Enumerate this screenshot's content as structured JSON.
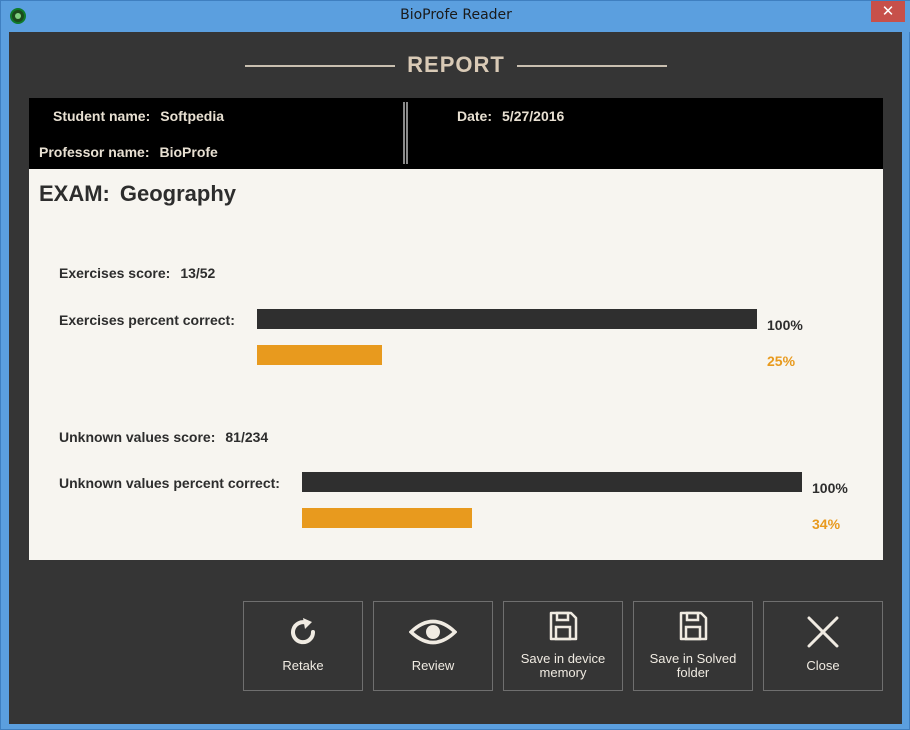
{
  "window": {
    "title": "BioProfe Reader",
    "close_glyph": "✕"
  },
  "report": {
    "title": "REPORT"
  },
  "info": {
    "student_label": "Student name:",
    "student_value": "Softpedia",
    "professor_label": "Professor name:",
    "professor_value": "BioProfe",
    "date_label": "Date:",
    "date_value": "5/27/2016"
  },
  "exam": {
    "label": "EXAM:",
    "name": "Geography"
  },
  "exercises": {
    "score_label": "Exercises score:",
    "score_value": "13/52",
    "percent_label": "Exercises percent correct:",
    "full_text": "100%",
    "pct_text": "25%",
    "fraction": 0.25
  },
  "unknown": {
    "score_label": "Unknown values score:",
    "score_value": "81/234",
    "percent_label": "Unknown values percent correct:",
    "full_text": "100%",
    "pct_text": "34%",
    "fraction": 0.34
  },
  "buttons": {
    "retake": {
      "label": "Retake",
      "icon": "refresh-icon"
    },
    "review": {
      "label": "Review",
      "icon": "eye-icon"
    },
    "save_device": {
      "line1": "Save in device",
      "line2": "memory",
      "icon": "floppy-disk-icon"
    },
    "save_solved": {
      "line1": "Save in Solved",
      "line2": "folder",
      "icon": "floppy-disk-icon"
    },
    "close": {
      "label": "Close",
      "icon": "close-icon"
    }
  },
  "colors": {
    "accent": "#e89a1e",
    "bar_dark": "#2f2f2f",
    "panel_bg": "#f7f5f0",
    "frame": "#353535"
  }
}
